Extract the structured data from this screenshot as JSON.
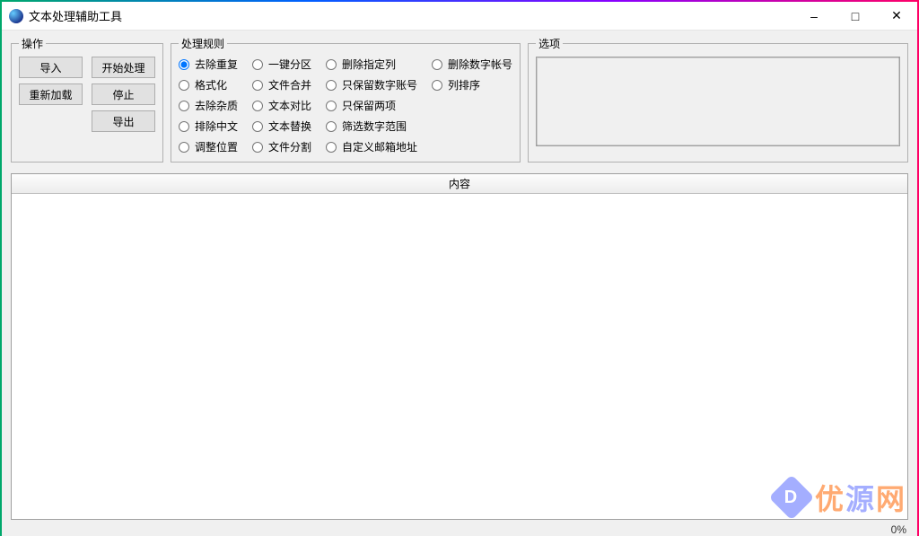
{
  "window": {
    "title": "文本处理辅助工具"
  },
  "groups": {
    "ops": "操作",
    "rules": "处理规则",
    "options": "选项"
  },
  "buttons": {
    "import": "导入",
    "start": "开始处理",
    "reload": "重新加载",
    "stop": "停止",
    "export": "导出"
  },
  "rules": {
    "col1": {
      "dedup": "去除重复",
      "format": "格式化",
      "clean": "去除杂质",
      "exclude_cn": "排除中文",
      "adjust_pos": "调整位置"
    },
    "col2": {
      "partition": "一键分区",
      "merge": "文件合并",
      "compare": "文本对比",
      "replace": "文本替换",
      "split": "文件分割"
    },
    "col3": {
      "del_col": "删除指定列",
      "keep_num_acct": "只保留数字账号",
      "keep_two": "只保留两项",
      "filter_num_range": "筛选数字范围",
      "custom_email": "自定义邮箱地址"
    },
    "col4": {
      "del_num_acct": "删除数字帐号",
      "col_sort": "列排序"
    },
    "selected": "dedup"
  },
  "content": {
    "header": "内容"
  },
  "status": {
    "progress": "0%"
  },
  "watermark": {
    "text1": "优",
    "text2": "源",
    "text3": "网"
  }
}
